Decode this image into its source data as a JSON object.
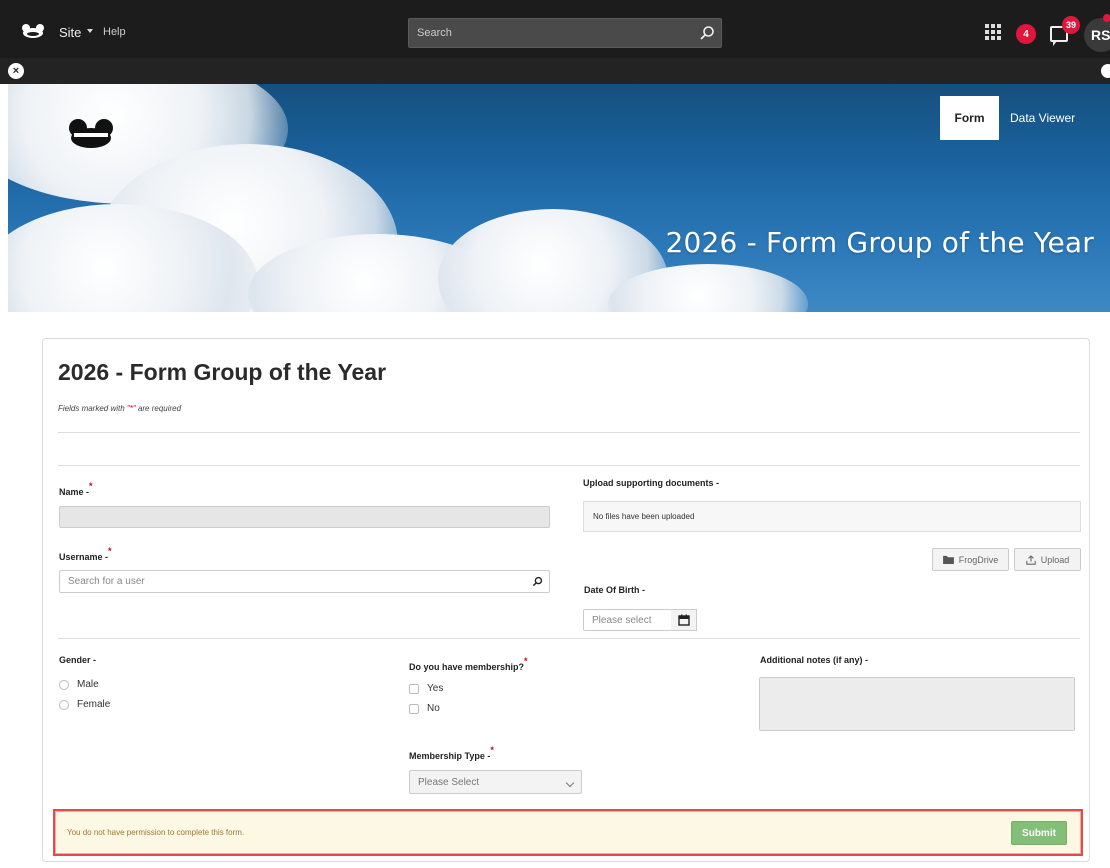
{
  "topbar": {
    "site_label": "Site",
    "help_label": "Help",
    "search_placeholder": "Search",
    "alerts_count": "4",
    "messages_count": "39",
    "avatar_initials": "RS"
  },
  "subbar": {
    "close_glyph": "×"
  },
  "hero": {
    "tabs": [
      {
        "label": "Form",
        "active": true
      },
      {
        "label": "Data Viewer",
        "active": false
      }
    ],
    "title": "2026 - Form Group of the Year"
  },
  "form": {
    "title": "2026 - Form Group of the Year",
    "required_note_prefix": "Fields marked with ",
    "required_note_mark": "\"*\"",
    "required_note_suffix": " are required",
    "name": {
      "label": "Name -",
      "value": ""
    },
    "username": {
      "label": "Username -",
      "placeholder": "Search for a user"
    },
    "upload": {
      "label": "Upload supporting documents -",
      "status": "No files have been uploaded",
      "frogdrive_label": "FrogDrive",
      "upload_label": "Upload"
    },
    "dob": {
      "label": "Date Of Birth -",
      "placeholder": "Please select"
    },
    "gender": {
      "label": "Gender -",
      "options": [
        "Male",
        "Female"
      ]
    },
    "membership": {
      "label": "Do you have membership?",
      "options": [
        "Yes",
        "No"
      ]
    },
    "membership_type": {
      "label": "Membership Type -",
      "selected": "Please Select"
    },
    "notes": {
      "label": "Additional notes (if any) -"
    },
    "warning": "You do not have permission to complete this form.",
    "submit_label": "Submit"
  },
  "colors": {
    "topbar": "#1c1c1c",
    "badge": "#e0163d",
    "submit": "#84bf77",
    "warning_bg": "#fcf8e3",
    "warning_text": "#a3782d",
    "highlight_border": "#e34b4b"
  },
  "icons": [
    "frog-logo-icon",
    "search-icon",
    "apps-grid-icon",
    "message-icon",
    "close-icon",
    "folder-icon",
    "upload-icon",
    "calendar-icon",
    "magnifier-icon",
    "chevron-down-icon"
  ]
}
